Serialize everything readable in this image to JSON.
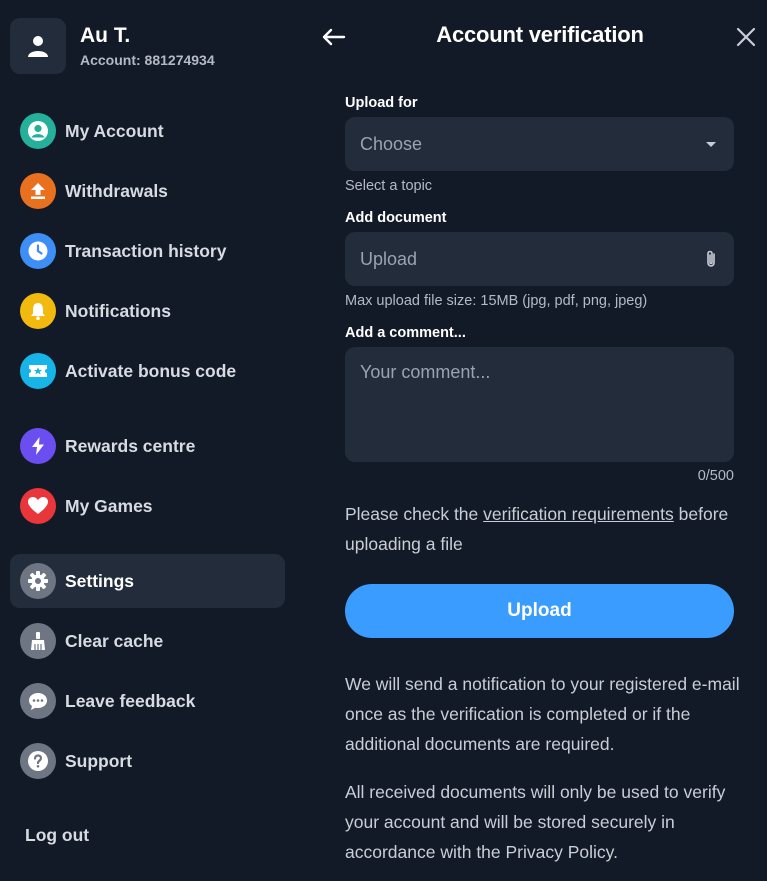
{
  "profile": {
    "name": "Au T.",
    "account": "Account: 881274934"
  },
  "menu": [
    {
      "label": "My Account",
      "icon": "user-circle-icon",
      "color": "#24b09a"
    },
    {
      "label": "Withdrawals",
      "icon": "upload-arrow-icon",
      "color": "#e8701f"
    },
    {
      "label": "Transaction history",
      "icon": "clock-icon",
      "color": "#3d8ef5"
    },
    {
      "label": "Notifications",
      "icon": "bell-icon",
      "color": "#f2b90f"
    },
    {
      "label": "Activate bonus code",
      "icon": "ticket-icon",
      "color": "#17b4e8"
    },
    {
      "label": "Rewards centre",
      "icon": "lightning-icon",
      "color": "#6b4ef0"
    },
    {
      "label": "My Games",
      "icon": "heart-icon",
      "color": "#e8363a"
    },
    {
      "label": "Settings",
      "icon": "gear-icon",
      "color": "#6e7683",
      "active": true
    },
    {
      "label": "Clear cache",
      "icon": "broom-icon",
      "color": "#6e7683"
    },
    {
      "label": "Leave feedback",
      "icon": "chat-icon",
      "color": "#6e7683"
    },
    {
      "label": "Support",
      "icon": "question-icon",
      "color": "#6e7683"
    }
  ],
  "logout_label": "Log out",
  "header": {
    "title": "Account verification"
  },
  "form": {
    "upload_for_label": "Upload for",
    "upload_for_value": "Choose",
    "upload_for_hint": "Select a topic",
    "document_label": "Add document",
    "document_value": "Upload",
    "document_hint": "Max upload file size: 15MB (jpg, pdf, png, jpeg)",
    "comment_label": "Add a comment...",
    "comment_placeholder": "Your comment...",
    "comment_counter": "0/500"
  },
  "check_text": {
    "before": "Please check the ",
    "link": "verification requirements",
    "after": " before uploading a file"
  },
  "upload_button": "Upload",
  "info_1": "We will send a notification to your registered e-mail once as the verification is completed or if the additional documents are required.",
  "info_2": "All received documents will only be used to verify your account and will be stored securely in accordance with the Privacy Policy.",
  "colors": {
    "background": "#131a27",
    "surface": "#232c3b",
    "accent": "#3b9cff"
  }
}
